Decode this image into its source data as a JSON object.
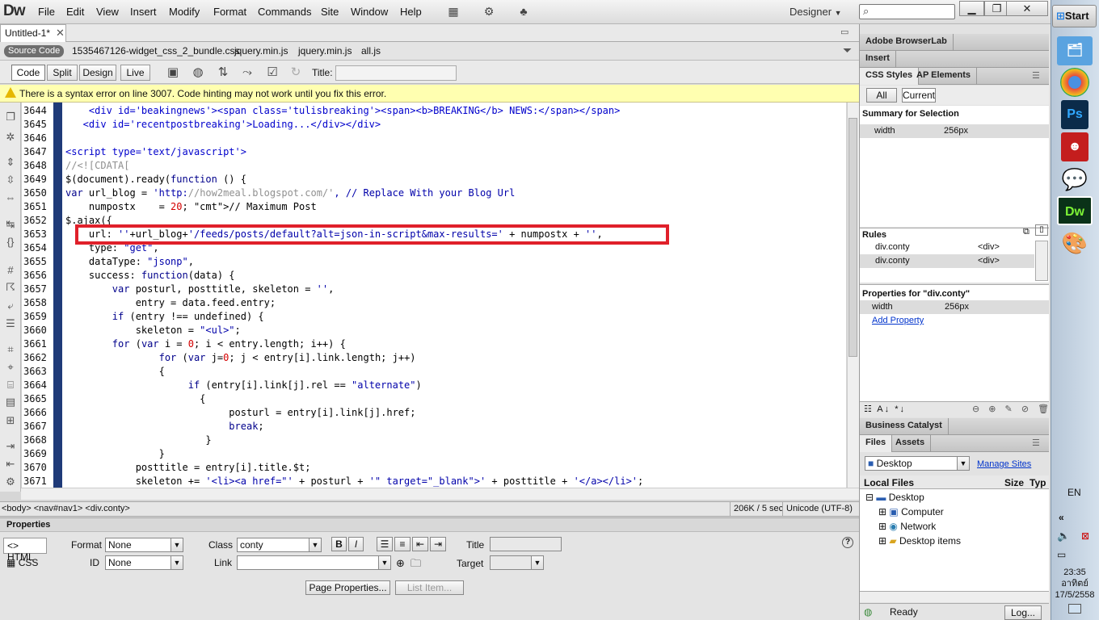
{
  "app": {
    "logo": "Dw",
    "workspace": "Designer"
  },
  "menu": [
    "File",
    "Edit",
    "View",
    "Insert",
    "Modify",
    "Format",
    "Commands",
    "Site",
    "Window",
    "Help"
  ],
  "doc_tab": {
    "label": "Untitled-1*"
  },
  "related_files": {
    "source": "Source Code",
    "files": [
      "1535467126-widget_css_2_bundle.css",
      "jquery.min.js",
      "jquery.min.js",
      "all.js"
    ]
  },
  "view_buttons": {
    "code": "Code",
    "split": "Split",
    "design": "Design",
    "live": "Live",
    "title_label": "Title:"
  },
  "error_message": "There is a syntax error on line 3007.  Code hinting may not work until you fix this error.",
  "code": {
    "lines": [
      {
        "n": "3644",
        "t": "    <div id='beakingnews'><span class='tulisbreaking'><span><b>BREAKING</b> NEWS:</span></span>"
      },
      {
        "n": "3645",
        "t": "   <div id='recentpostbreaking'>Loading...</div></div>"
      },
      {
        "n": "3646",
        "t": ""
      },
      {
        "n": "3647",
        "t": "<script type='text/javascript'>"
      },
      {
        "n": "3648",
        "t": "//<![CDATA["
      },
      {
        "n": "3649",
        "t": "$(document).ready(function () {"
      },
      {
        "n": "3650",
        "t": "var url_blog = 'http://how2meal.blogspot.com/', // Replace With your Blog Url"
      },
      {
        "n": "3651",
        "t": "    numpostx    = 20; // Maximum Post"
      },
      {
        "n": "3652",
        "t": "$.ajax({"
      },
      {
        "n": "3653",
        "t": "    url: ''+url_blog+'/feeds/posts/default?alt=json-in-script&max-results=' + numpostx + '',"
      },
      {
        "n": "3654",
        "t": "    type: \"get\","
      },
      {
        "n": "3655",
        "t": "    dataType: \"jsonp\","
      },
      {
        "n": "3656",
        "t": "    success: function(data) {"
      },
      {
        "n": "3657",
        "t": "        var posturl, posttitle, skeleton = '',"
      },
      {
        "n": "3658",
        "t": "            entry = data.feed.entry;"
      },
      {
        "n": "3659",
        "t": "        if (entry !== undefined) {"
      },
      {
        "n": "3660",
        "t": "            skeleton = \"<ul>\";"
      },
      {
        "n": "3661",
        "t": "        for (var i = 0; i < entry.length; i++) {"
      },
      {
        "n": "3662",
        "t": "                for (var j=0; j < entry[i].link.length; j++)"
      },
      {
        "n": "3663",
        "t": "                {"
      },
      {
        "n": "3664",
        "t": "                     if (entry[i].link[j].rel == \"alternate\")"
      },
      {
        "n": "3665",
        "t": "                       {"
      },
      {
        "n": "3666",
        "t": "                            posturl = entry[i].link[j].href;"
      },
      {
        "n": "3667",
        "t": "                            break;"
      },
      {
        "n": "3668",
        "t": "                        }"
      },
      {
        "n": "3669",
        "t": "                }"
      },
      {
        "n": "3670",
        "t": "            posttitle = entry[i].title.$t;"
      },
      {
        "n": "3671",
        "t": "            skeleton += '<li><a href=\"' + posturl + '\" target=\"_blank\">' + posttitle + '</a></li>';"
      }
    ]
  },
  "status_bar": {
    "tag_selector": "<body> <nav#nav1> <div.conty>",
    "size": "206K / 5 sec",
    "encoding": "Unicode (UTF-8)"
  },
  "properties": {
    "title": "Properties",
    "html_label": "HTML",
    "css_label": "CSS",
    "format_label": "Format",
    "format_value": "None",
    "id_label": "ID",
    "id_value": "None",
    "class_label": "Class",
    "class_value": "conty",
    "link_label": "Link",
    "link_value": "",
    "title_label": "Title",
    "target_label": "Target",
    "page_properties": "Page Properties...",
    "list_item": "List Item..."
  },
  "panels": {
    "browserlab": "Adobe BrowserLab",
    "insert": "Insert",
    "css_tab": "CSS Styles",
    "ap_tab": "AP Elements",
    "all_btn": "All",
    "current_btn": "Current",
    "summary_title": "Summary for Selection",
    "summary_rows": [
      {
        "prop": "width",
        "value": "256px"
      }
    ],
    "rules_title": "Rules",
    "rules": [
      {
        "sel": "div.conty",
        "tag": "<div>"
      },
      {
        "sel": "div.conty",
        "tag": "<div>"
      }
    ],
    "props_title": "Properties for \"div.conty\"",
    "props_rows": [
      {
        "prop": "width",
        "value": "256px"
      }
    ],
    "add_property": "Add Property",
    "business_catalyst": "Business Catalyst",
    "files_tab": "Files",
    "assets_tab": "Assets",
    "site_select": "Desktop",
    "manage_sites": "Manage Sites",
    "local_files": "Local Files",
    "size_col": "Size",
    "type_col": "Typ",
    "tree": [
      "Desktop",
      "Computer",
      "Network",
      "Desktop items"
    ],
    "ready": "Ready",
    "log_btn": "Log..."
  },
  "taskbar": {
    "start": "Start",
    "lang": "EN",
    "time": "23:35",
    "day": "อาทิตย์",
    "date": "17/5/2558"
  },
  "colors": {
    "highlight_box": "#e0202a",
    "gutter": "#1f3a78",
    "error_bar": "#ffffb0"
  }
}
